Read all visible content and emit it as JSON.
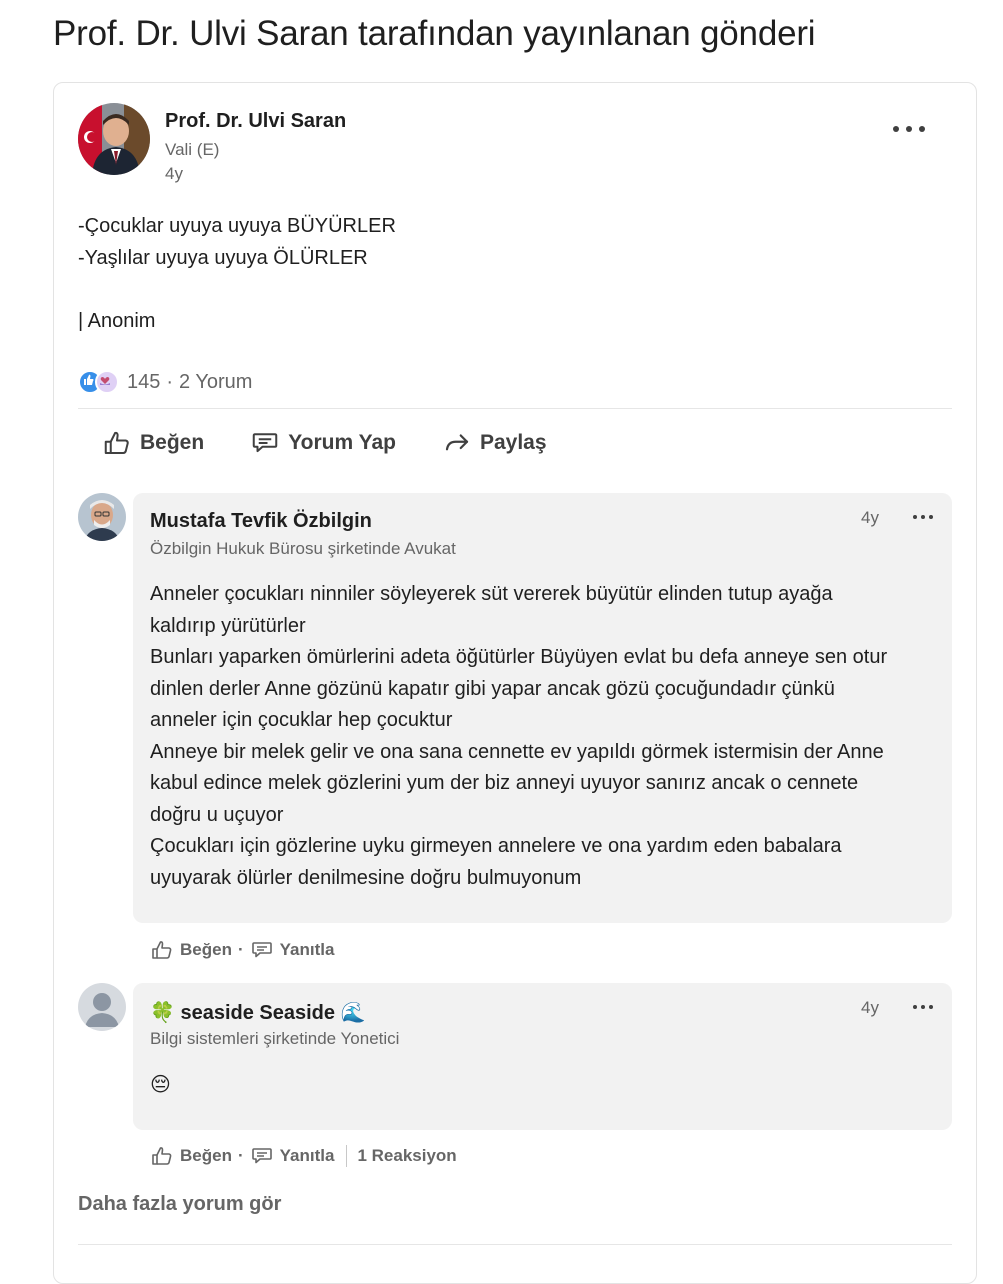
{
  "page": {
    "title": "Prof. Dr. Ulvi Saran tarafından yayınlanan gönderi"
  },
  "post": {
    "author": {
      "name": "Prof. Dr. Ulvi Saran",
      "subtitle": "Vali (E)",
      "time": "4y"
    },
    "text": "-Çocuklar uyuya uyuya BÜYÜRLER\n-Yaşlılar uyuya uyuya ÖLÜRLER\n\n| Anonim",
    "reactions": {
      "count": "145",
      "separator": "·",
      "comments": "2 Yorum"
    },
    "actions": {
      "like": "Beğen",
      "comment": "Yorum Yap",
      "share": "Paylaş"
    }
  },
  "comments": [
    {
      "name": "Mustafa Tevfik Özbilgin",
      "subtitle": "Özbilgin Hukuk Bürosu şirketinde Avukat",
      "time": "4y",
      "text": "Anneler çocukları ninniler söyleyerek süt vererek büyütür elinden tutup ayağa\nkaldırıp yürütürler\nBunları yaparken ömürlerini adeta öğütürler Büyüyen evlat bu defa anneye sen otur\ndinlen derler Anne gözünü kapatır gibi yapar ancak gözü çocuğundadır çünkü\nanneler için çocuklar hep çocuktur\nAnneye bir melek gelir ve ona sana cennette ev yapıldı görmek istermisin der Anne\nkabul edince melek gözlerini yum der biz anneyi uyuyor sanırız ancak o cennete\ndoğru u uçuyor\nÇocukları için gözlerine uyku girmeyen annelere ve ona yardım eden babalara\nuyuyarak ölürler denilmesine doğru bulmuyonum",
      "like": "Beğen",
      "dot": "·",
      "reply": "Yanıtla"
    },
    {
      "name_prefix": "🍀",
      "name": "seaside Seaside",
      "name_suffix": "🌊",
      "subtitle": "Bilgi sistemleri şirketinde Yonetici",
      "time": "4y",
      "text": "😔",
      "like": "Beğen",
      "dot": "·",
      "reply": "Yanıtla",
      "reactions": "1 Reaksiyon"
    }
  ],
  "more_comments": "Daha fazla yorum gör"
}
